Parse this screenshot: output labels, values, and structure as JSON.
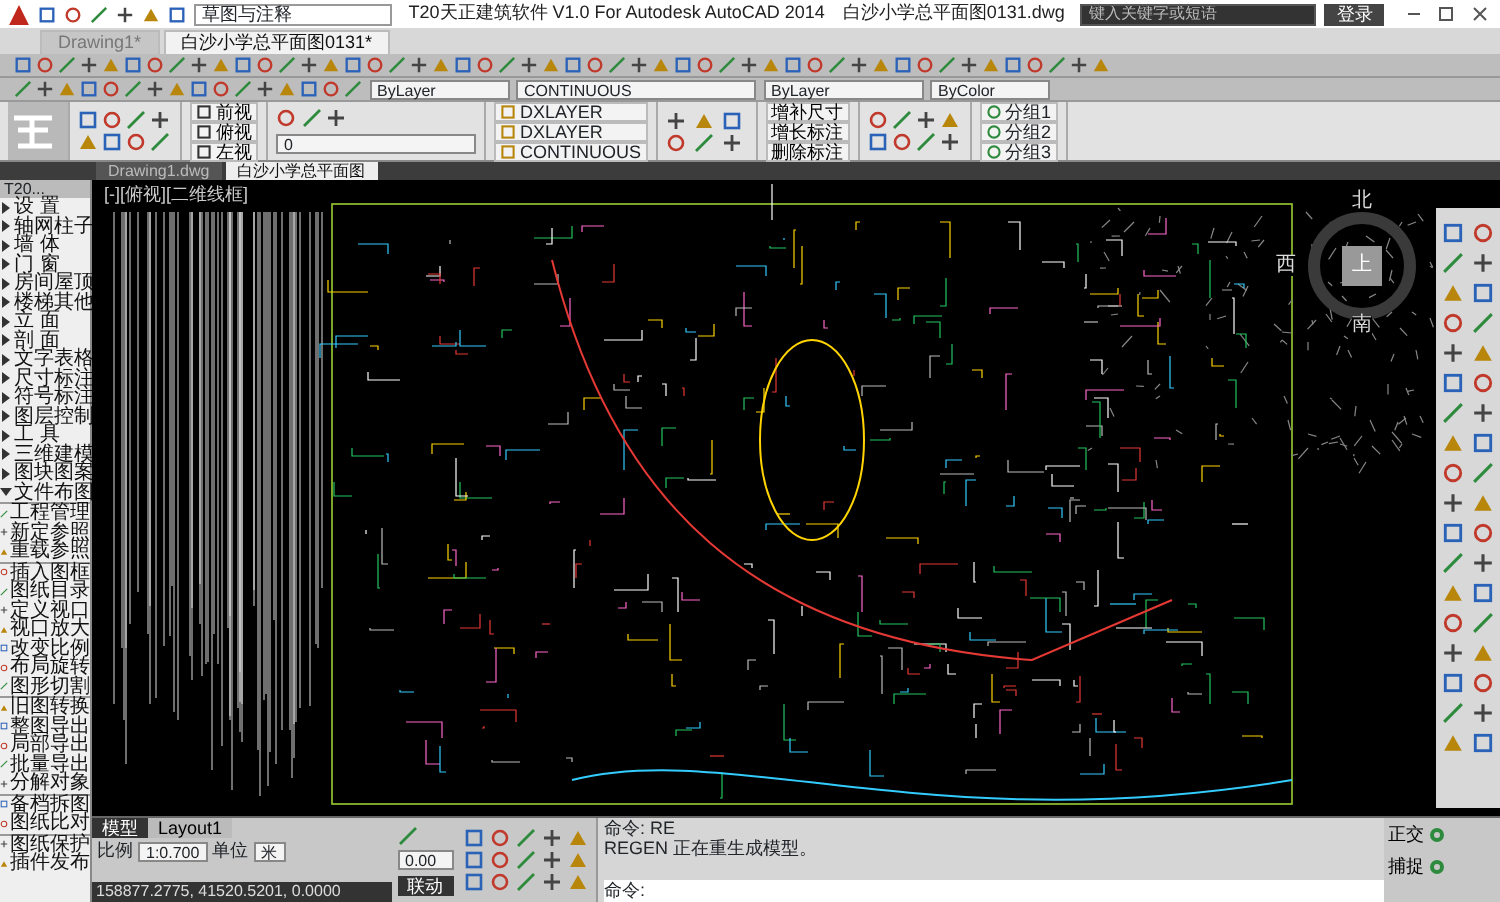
{
  "title_bar": {
    "workspace": "草图与注释",
    "title": "T20天正建筑软件 V1.0 For Autodesk AutoCAD 2014",
    "file": "白沙小学总平面图0131.dwg",
    "search": {
      "placeholder": "键入关键字或短语"
    },
    "sign_in": "登录"
  },
  "doc_tabs": [
    {
      "label": "Drawing1*",
      "selected": false
    },
    {
      "label": "白沙小学总平面图0131*",
      "selected": true
    }
  ],
  "properties": {
    "color_control": "ByLayer",
    "linetype": "CONTINUOUS",
    "lineweight": "ByLayer",
    "plotstyle": "ByColor"
  },
  "ribbon": {
    "views": [
      "前视",
      "俯视",
      "左视"
    ],
    "layer_name": "0",
    "layers": [
      "DXLAYER",
      "DXLAYER",
      "CONTINUOUS"
    ],
    "dim_buttons": [
      "增补尺寸",
      "增长标注",
      "删除标注"
    ],
    "groups": [
      "分组1",
      "分组2",
      "分组3"
    ]
  },
  "file_tabs": [
    {
      "label": "Drawing1.dwg",
      "selected": false
    },
    {
      "label": "白沙小学总平面图",
      "selected": true
    }
  ],
  "side_panel": {
    "title": "T20...",
    "items": [
      {
        "label": "设 置",
        "kind": "submenu",
        "expanded": false
      },
      {
        "label": "轴网柱子",
        "kind": "submenu",
        "expanded": false
      },
      {
        "label": "墙 体",
        "kind": "submenu",
        "expanded": false
      },
      {
        "label": "门 窗",
        "kind": "submenu",
        "expanded": false
      },
      {
        "label": "房间屋顶",
        "kind": "submenu",
        "expanded": false
      },
      {
        "label": "楼梯其他",
        "kind": "submenu",
        "expanded": false
      },
      {
        "label": "立 面",
        "kind": "submenu",
        "expanded": false
      },
      {
        "label": "剖 面",
        "kind": "submenu",
        "expanded": false
      },
      {
        "label": "文字表格",
        "kind": "submenu",
        "expanded": false
      },
      {
        "label": "尺寸标注",
        "kind": "submenu",
        "expanded": false
      },
      {
        "label": "符号标注",
        "kind": "submenu",
        "expanded": false
      },
      {
        "label": "图层控制",
        "kind": "submenu",
        "expanded": false
      },
      {
        "label": "工 具",
        "kind": "submenu",
        "expanded": false
      },
      {
        "label": "三维建模",
        "kind": "submenu",
        "expanded": false
      },
      {
        "label": "图块图案",
        "kind": "submenu",
        "expanded": false
      },
      {
        "label": "文件布图",
        "kind": "submenu",
        "expanded": true
      },
      {
        "kind": "separator"
      },
      {
        "label": "工程管理",
        "kind": "command"
      },
      {
        "label": "新定参照",
        "kind": "command"
      },
      {
        "label": "重载参照",
        "kind": "command"
      },
      {
        "kind": "separator"
      },
      {
        "label": "插入图框",
        "kind": "command"
      },
      {
        "label": "图纸目录",
        "kind": "command"
      },
      {
        "label": "定义视口",
        "kind": "command"
      },
      {
        "label": "视口放大",
        "kind": "command"
      },
      {
        "label": "改变比例",
        "kind": "command"
      },
      {
        "label": "布局旋转",
        "kind": "command"
      },
      {
        "label": "图形切割",
        "kind": "command"
      },
      {
        "kind": "separator"
      },
      {
        "label": "旧图转换",
        "kind": "command"
      },
      {
        "label": "整图导出",
        "kind": "command"
      },
      {
        "label": "局部导出",
        "kind": "command"
      },
      {
        "label": "批量导出",
        "kind": "command"
      },
      {
        "label": "分解对象",
        "kind": "command"
      },
      {
        "kind": "separator"
      },
      {
        "label": "备档拆图",
        "kind": "command"
      },
      {
        "label": "图纸比对",
        "kind": "command"
      },
      {
        "kind": "separator"
      },
      {
        "label": "图纸保护",
        "kind": "command"
      },
      {
        "label": "插件发布",
        "kind": "command"
      }
    ]
  },
  "viewport_label": "[-][俯视][二维线框]",
  "viewcube": {
    "north": "北",
    "south": "南",
    "west": "西",
    "top": "上"
  },
  "layout_tabs": [
    {
      "label": "模型",
      "selected": true
    },
    {
      "label": "Layout1",
      "selected": false
    }
  ],
  "status": {
    "scale_label": "比例",
    "scale": "1:0.700",
    "unit_label": "单位",
    "unit": "米",
    "coords": "158877.2775, 41520.5201, 0.0000",
    "elevation": "0.00",
    "link": "联动"
  },
  "command": {
    "history": [
      "命令: RE",
      "REGEN 正在重生成模型。"
    ],
    "prompt": "命令:"
  },
  "toggles": [
    {
      "label": "正交",
      "on": true
    },
    {
      "label": "捕捉",
      "on": true
    }
  ]
}
